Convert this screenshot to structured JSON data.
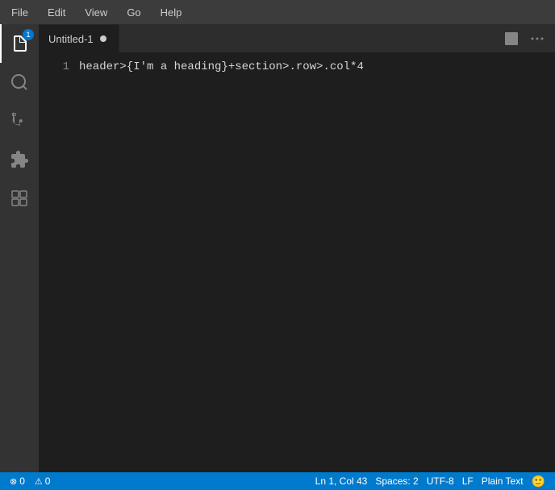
{
  "menubar": {
    "items": [
      "File",
      "Edit",
      "View",
      "Go",
      "Help"
    ]
  },
  "activity_bar": {
    "icons": [
      {
        "name": "files-icon",
        "label": "Explorer",
        "active": true,
        "badge": "1"
      },
      {
        "name": "search-icon",
        "label": "Search",
        "active": false
      },
      {
        "name": "source-control-icon",
        "label": "Source Control",
        "active": false
      },
      {
        "name": "extensions-icon",
        "label": "Extensions",
        "active": false
      },
      {
        "name": "remote-icon",
        "label": "Remote",
        "active": false
      }
    ]
  },
  "tab": {
    "title": "Untitled-1",
    "modified": true
  },
  "editor": {
    "lines": [
      {
        "number": "1",
        "content": "header>{I'm a heading}+section>.row>.col*4"
      }
    ]
  },
  "statusbar": {
    "errors": "0",
    "warnings": "0",
    "position": "Ln 1, Col 43",
    "spaces": "Spaces: 2",
    "encoding": "UTF-8",
    "line_ending": "LF",
    "language": "Plain Text",
    "error_icon": "⊗",
    "warning_icon": "⚠"
  }
}
